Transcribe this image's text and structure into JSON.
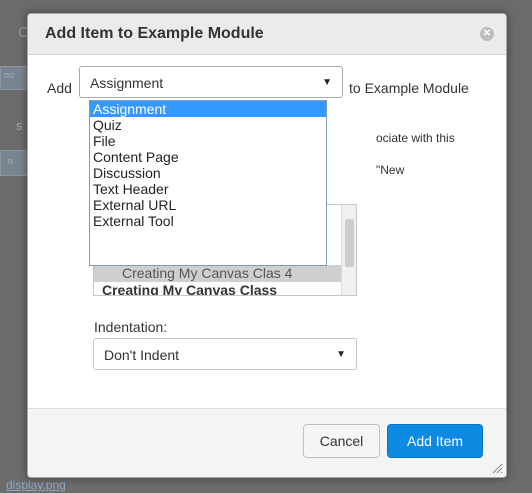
{
  "background": {
    "fragments": [
      "Ca",
      "ou",
      "s",
      "n"
    ],
    "file_link": "display.png"
  },
  "dialog": {
    "title": "Add Item to Example Module",
    "close_icon": "close-icon",
    "add_label": "Add",
    "to_label": "to Example Module",
    "type_select": {
      "value": "Assignment",
      "options": [
        "Assignment",
        "Quiz",
        "File",
        "Content Page",
        "Discussion",
        "Text Header",
        "External URL",
        "External Tool"
      ],
      "selected_index": 0
    },
    "hint_line1": "ociate with this",
    "hint_line2": "\"New",
    "item_list": {
      "items": [
        "Creating My Canvas Clas 4",
        "Creating My Canvas Class"
      ],
      "selected_index": 0
    },
    "indentation": {
      "label": "Indentation:",
      "value": "Don't Indent"
    },
    "buttons": {
      "cancel": "Cancel",
      "add": "Add Item"
    }
  },
  "colors": {
    "accent": "#0e8ae2",
    "dropdown_highlight": "#3399ff",
    "overlay": "#6b6b6b"
  }
}
